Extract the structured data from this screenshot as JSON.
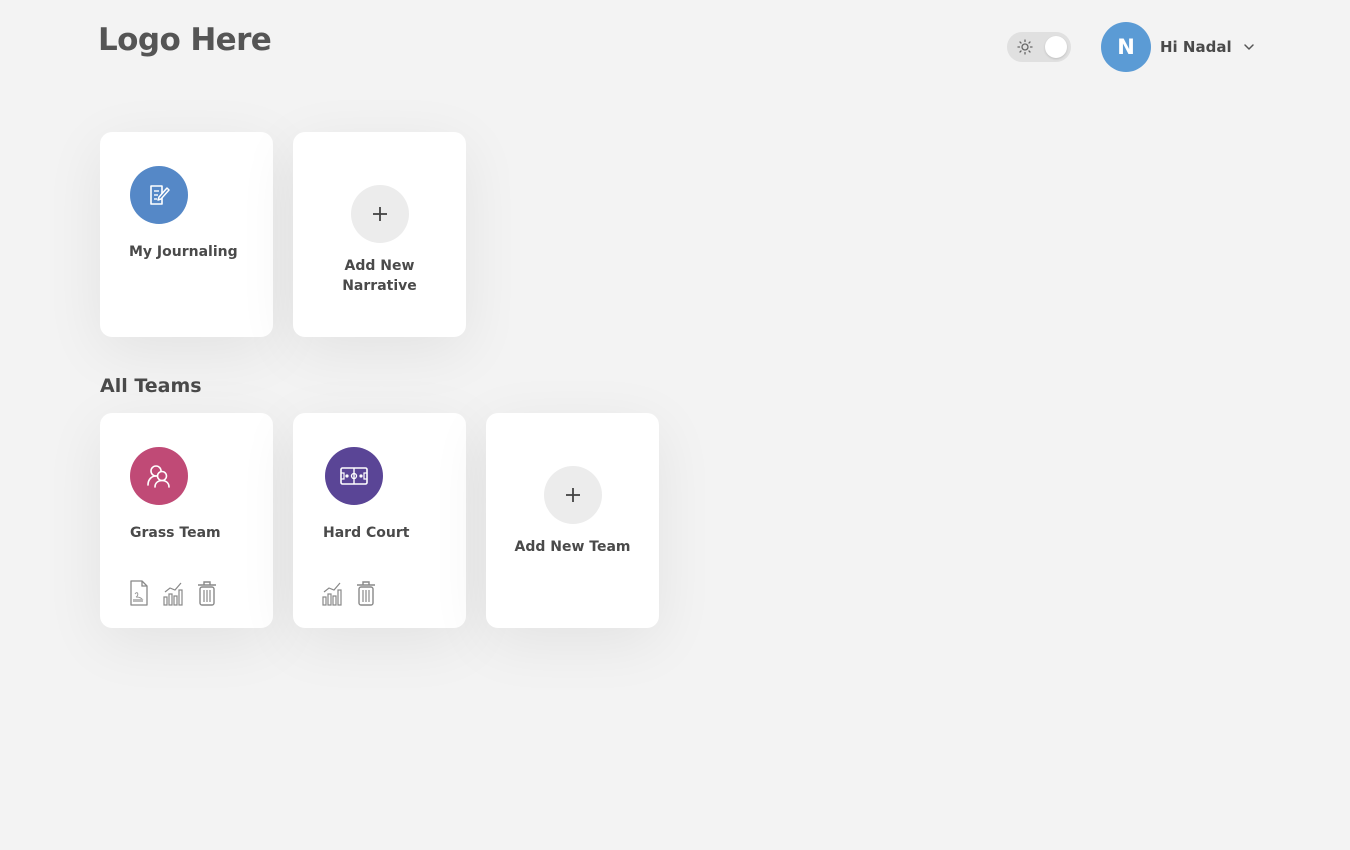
{
  "header": {
    "logo": "Logo Here",
    "theme_toggle_icon": "sun-icon",
    "user": {
      "initial": "N",
      "greeting": "Hi Nadal",
      "avatar_color": "#5b9bd5"
    }
  },
  "journals": [
    {
      "title": "My Journaling",
      "icon": "journal-edit-icon",
      "color": "#5588c7"
    }
  ],
  "add_narrative": {
    "label": "Add New Narrative"
  },
  "teams_section": {
    "title": "All Teams"
  },
  "teams": [
    {
      "title": "Grass Team",
      "icon": "team-members-icon",
      "color": "#c04a76",
      "actions": [
        "pdf-icon",
        "stats-chart-icon",
        "trash-icon"
      ]
    },
    {
      "title": "Hard Court",
      "icon": "court-icon",
      "color": "#5a4596",
      "actions": [
        "stats-chart-icon",
        "trash-icon"
      ]
    }
  ],
  "add_team": {
    "label": "Add New Team"
  }
}
